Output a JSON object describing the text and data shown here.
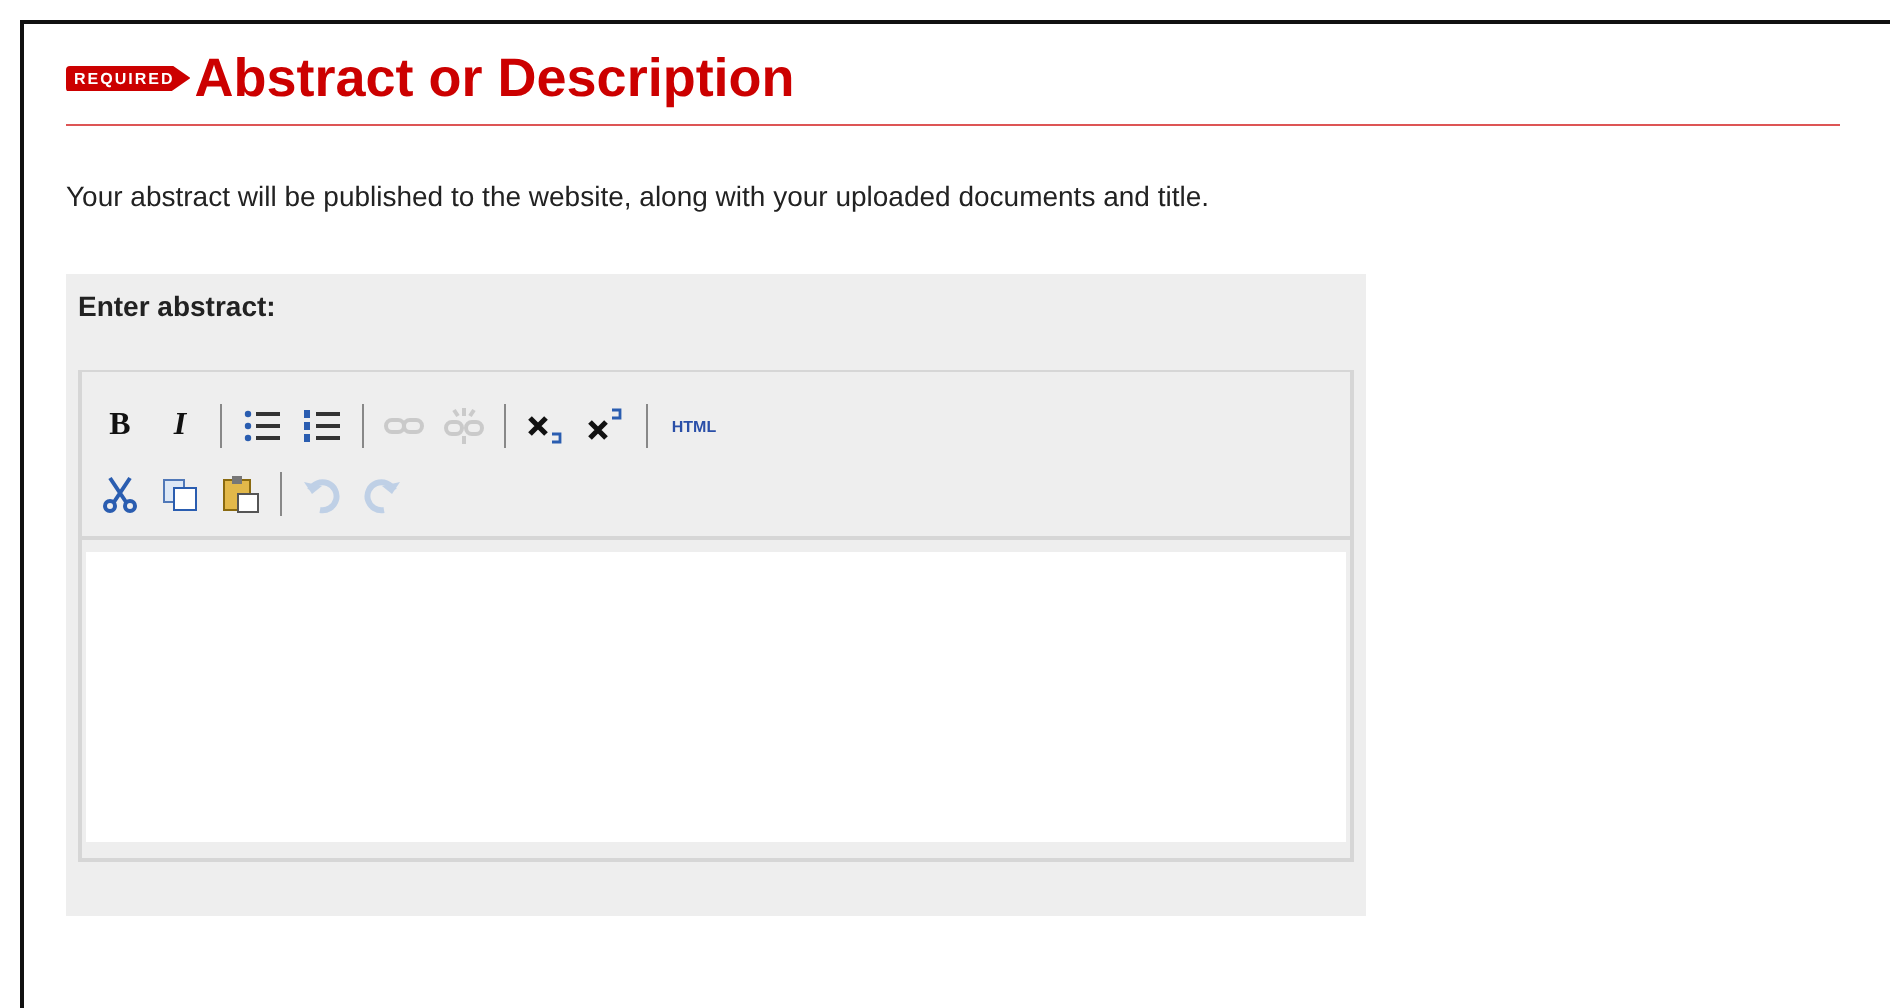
{
  "section": {
    "badge": "REQUIRED",
    "title": "Abstract or Description"
  },
  "intro": "Your abstract will be published to the website, along with your uploaded documents and title.",
  "editor": {
    "label": "Enter abstract:",
    "toolbar_rows": [
      [
        {
          "kind": "bold",
          "label": "B",
          "disabled": false
        },
        {
          "kind": "italic",
          "label": "I",
          "disabled": false
        },
        {
          "kind": "separator"
        },
        {
          "kind": "bullets",
          "disabled": false
        },
        {
          "kind": "numbers",
          "disabled": false
        },
        {
          "kind": "separator"
        },
        {
          "kind": "link",
          "disabled": true
        },
        {
          "kind": "unlink",
          "disabled": true
        },
        {
          "kind": "separator"
        },
        {
          "kind": "subscript",
          "disabled": false
        },
        {
          "kind": "superscript",
          "disabled": false
        },
        {
          "kind": "separator"
        },
        {
          "kind": "html",
          "label": "HTML",
          "disabled": false
        }
      ],
      [
        {
          "kind": "cut",
          "disabled": false
        },
        {
          "kind": "copy",
          "disabled": false
        },
        {
          "kind": "paste",
          "disabled": false
        },
        {
          "kind": "separator"
        },
        {
          "kind": "undo",
          "disabled": true
        },
        {
          "kind": "redo",
          "disabled": true
        }
      ]
    ]
  }
}
